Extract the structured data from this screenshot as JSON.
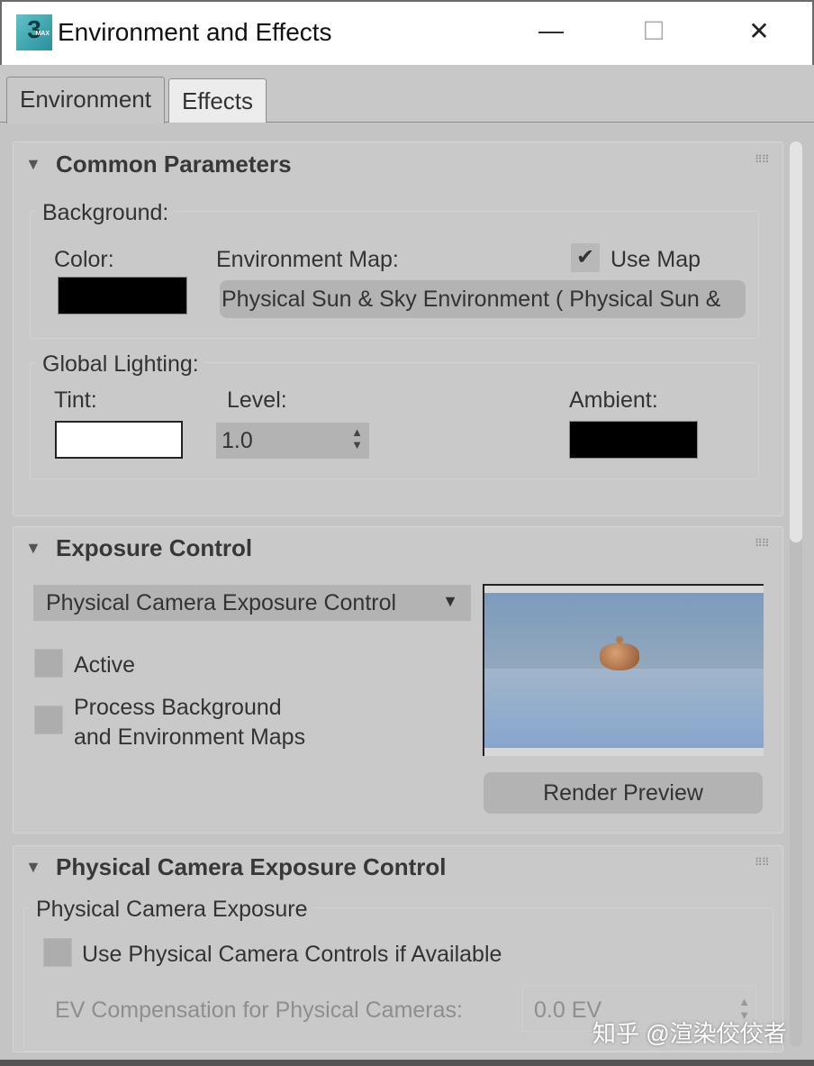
{
  "window": {
    "title": "Environment and Effects",
    "app_icon": "3ds-max-icon",
    "app_icon_text": "3",
    "app_icon_sub": "MAX",
    "minimize": "—",
    "maximize": "☐",
    "close": "✕"
  },
  "tabs": [
    {
      "label": "Environment",
      "active": true
    },
    {
      "label": "Effects",
      "active": false
    }
  ],
  "common": {
    "title": "Common Parameters",
    "background_label": "Background:",
    "color_label": "Color:",
    "color_value": "#000000",
    "env_map_label": "Environment Map:",
    "use_map_label": "Use Map",
    "use_map_checked": true,
    "env_map_value": "Physical Sun & Sky Environment  ( Physical Sun &",
    "global_lighting_label": "Global Lighting:",
    "tint_label": "Tint:",
    "tint_value": "#ffffff",
    "level_label": "Level:",
    "level_value": "1.0",
    "ambient_label": "Ambient:",
    "ambient_value": "#000000"
  },
  "exposure": {
    "title": "Exposure Control",
    "dropdown_value": "Physical Camera Exposure Control",
    "active_label": "Active",
    "active_checked": false,
    "process_label_1": "Process Background",
    "process_label_2": "and Environment Maps",
    "process_checked": false,
    "render_preview": "Render Preview"
  },
  "physical": {
    "title": "Physical Camera Exposure Control",
    "group_label": "Physical Camera Exposure",
    "use_controls_label": "Use Physical Camera Controls if Available",
    "use_controls_checked": false,
    "ev_label": "EV Compensation for Physical Cameras:",
    "ev_value": "0.0 EV"
  },
  "watermark": "知乎 @渲染佼佼者"
}
